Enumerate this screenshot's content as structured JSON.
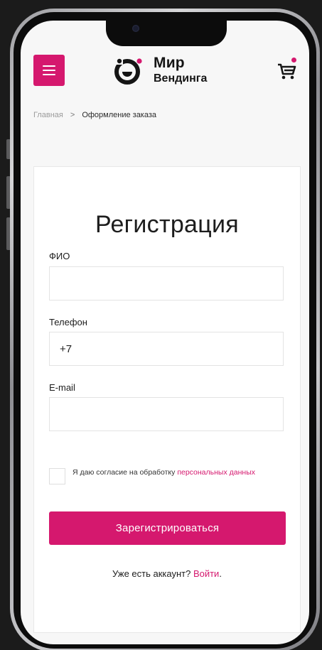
{
  "header": {
    "logo_title": "Мир",
    "logo_subtitle": "Вендинга"
  },
  "breadcrumb": {
    "home": "Главная",
    "separator": ">",
    "current": "Оформление заказа"
  },
  "form": {
    "title": "Регистрация",
    "fields": [
      {
        "label": "ФИО",
        "value": ""
      },
      {
        "label": "Телефон",
        "value": "+7"
      },
      {
        "label": "E-mail",
        "value": ""
      }
    ],
    "consent": {
      "text": "Я даю согласие на обработку ",
      "link": "персональных данных",
      "checked": false
    },
    "submit_label": "Зарегистрироваться",
    "login_prompt": "Уже есть аккаунт? ",
    "login_link": "Войти",
    "login_suffix": "."
  },
  "icons": {
    "menu": "hamburger-menu-icon",
    "cart": "shopping-cart-icon",
    "logo": "vending-logo-icon"
  },
  "colors": {
    "accent": "#d5186e",
    "background": "#f7f7f7",
    "card": "#ffffff",
    "text": "#1d1d1d"
  }
}
